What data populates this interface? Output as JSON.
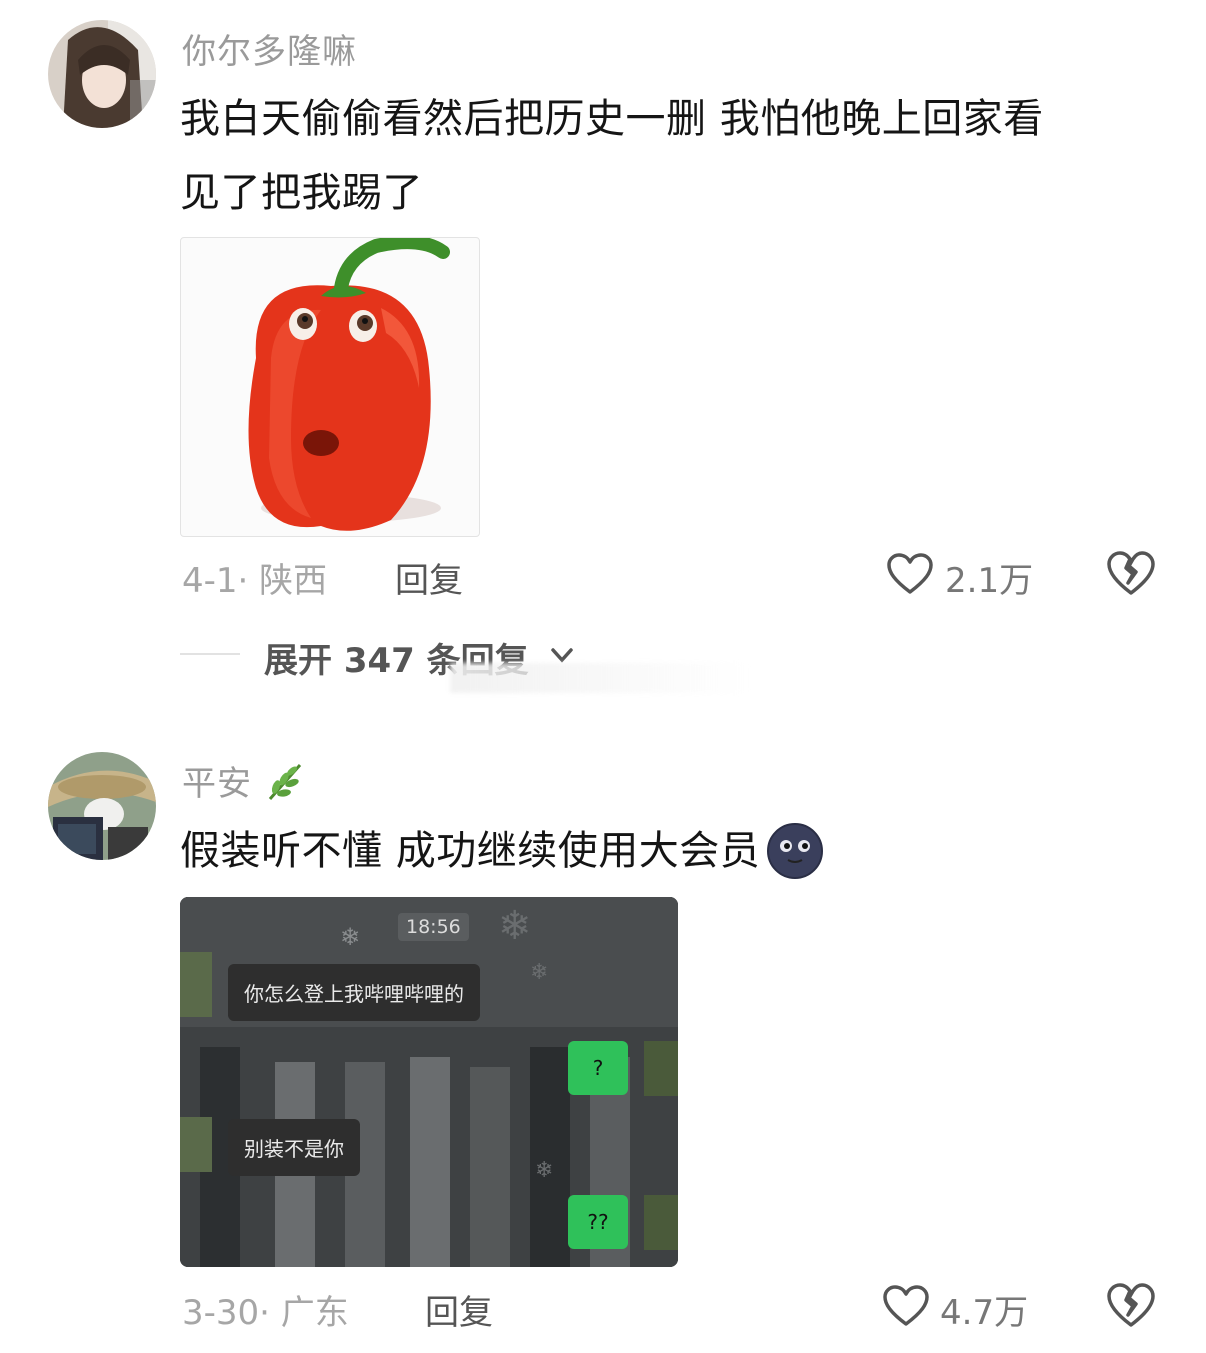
{
  "comments": [
    {
      "username": "你尔多隆嘛",
      "text_line1": "我白天偷偷看然后把历史一删 我怕他晚上回家看",
      "text_line2": "见了把我踢了",
      "meta": "4-1· 陕西",
      "reply_label": "回复",
      "likes": "2.1万",
      "expand_label": "展开 347 条回复"
    },
    {
      "username": "平安",
      "text": "假装听不懂 成功继续使用大会员",
      "meta": "3-30· 广东",
      "reply_label": "回复",
      "likes": "4.7万",
      "chat": {
        "time": "18:56",
        "msg1": "你怎么登上我哔哩哔哩的",
        "msg2": "?",
        "msg3": "别装不是你",
        "msg4": "??"
      }
    }
  ],
  "colors": {
    "accent_green": "#2fc15a",
    "pepper_red": "#e4341b"
  }
}
